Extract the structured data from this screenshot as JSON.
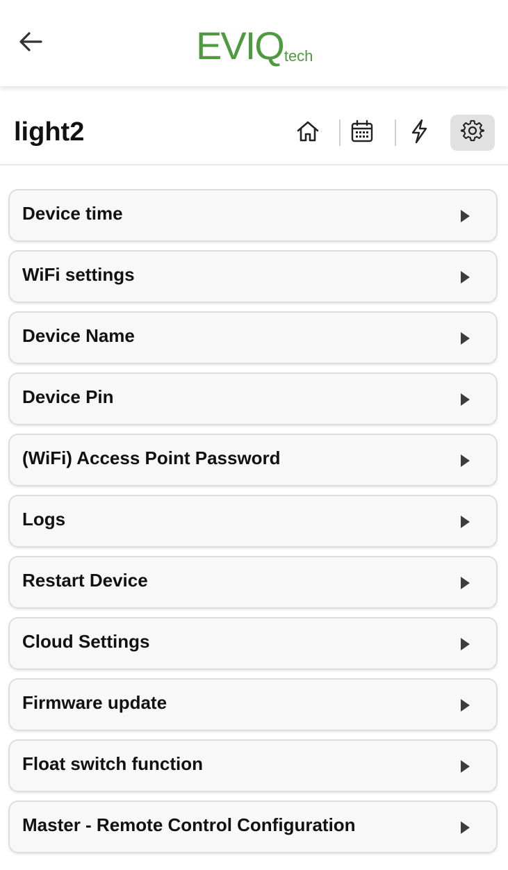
{
  "header": {
    "back_icon": "arrow-left-icon",
    "logo_main": "EVIQ",
    "logo_sub": "tech",
    "brand_color": "#4e9a3f"
  },
  "device": {
    "title": "light2",
    "nav": [
      {
        "name": "home",
        "icon": "home-icon",
        "active": false
      },
      {
        "name": "schedule",
        "icon": "calendar-icon",
        "active": false
      },
      {
        "name": "power",
        "icon": "lightning-icon",
        "active": false
      },
      {
        "name": "settings",
        "icon": "gear-icon",
        "active": true
      }
    ]
  },
  "menu": {
    "items": [
      {
        "label": "Device time"
      },
      {
        "label": "WiFi settings"
      },
      {
        "label": "Device Name"
      },
      {
        "label": "Device Pin"
      },
      {
        "label": "(WiFi) Access Point Password"
      },
      {
        "label": "Logs"
      },
      {
        "label": "Restart Device"
      },
      {
        "label": "Cloud Settings"
      },
      {
        "label": "Firmware update"
      },
      {
        "label": "Float switch function"
      },
      {
        "label": "Master - Remote Control Configuration"
      }
    ]
  }
}
